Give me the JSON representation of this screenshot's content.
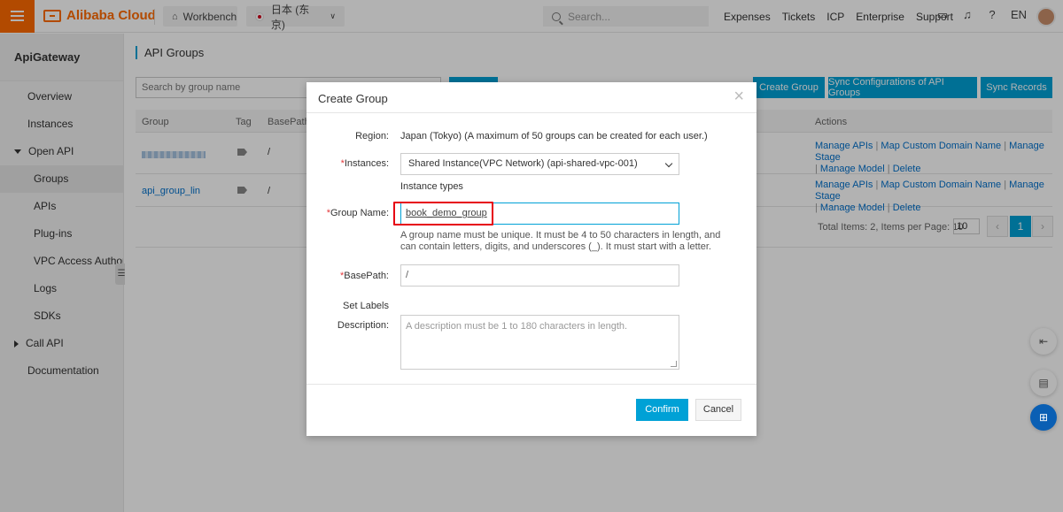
{
  "topbar": {
    "brand": "Alibaba Cloud",
    "workbench": "Workbench",
    "region": "日本 (东京)",
    "search_placeholder": "Search...",
    "links": [
      "Expenses",
      "Tickets",
      "ICP",
      "Enterprise",
      "Support"
    ],
    "language": "EN"
  },
  "sidebar": {
    "title": "ApiGateway",
    "items": {
      "overview": "Overview",
      "instances": "Instances",
      "open_api": "Open API",
      "groups": "Groups",
      "apis": "APIs",
      "plugins": "Plug-ins",
      "vpc": "VPC Access Authori...",
      "logs": "Logs",
      "sdks": "SDKs",
      "call_api": "Call API",
      "documentation": "Documentation"
    }
  },
  "main": {
    "title": "API Groups",
    "search_placeholder": "Search by group name",
    "buttons": {
      "create": "Create Group",
      "sync": "Sync Configurations of API Groups",
      "records": "Sync Records"
    },
    "columns": {
      "group": "Group",
      "tag": "Tag",
      "basepath": "BasePath",
      "actions": "Actions"
    },
    "rows": [
      {
        "group": "",
        "basepath": "/"
      },
      {
        "group": "api_group_lin",
        "basepath": "/"
      }
    ],
    "row_actions": {
      "manage_apis": "Manage APIs",
      "map_domain": "Map Custom Domain Name",
      "manage_stage": "Manage Stage",
      "manage_model": "Manage Model",
      "delete": "Delete"
    },
    "pagination": {
      "summary": "Total Items: 2, Items per Page: 10",
      "per_page": "10",
      "current": "1",
      "prev": "‹",
      "next": "›"
    }
  },
  "dialog": {
    "title": "Create Group",
    "close": "×",
    "region_label": "Region:",
    "region_value": "Japan (Tokyo) (A maximum of 50 groups can be created for each user.)",
    "instances_label": "Instances:",
    "instances_value": "Shared Instance(VPC Network) (api-shared-vpc-001)",
    "instance_types_link": "Instance types",
    "group_name_label": "Group Name:",
    "group_name_value": "book_demo_group",
    "group_name_hint": "A group name must be unique. It must be 4 to 50 characters in length, and can contain letters, digits, and underscores (_). It must start with a letter.",
    "basepath_label": "BasePath:",
    "basepath_value": "/",
    "set_labels_link": "Set Labels",
    "description_label": "Description:",
    "description_placeholder": "A description must be 1 to 180 characters in length.",
    "confirm": "Confirm",
    "cancel": "Cancel",
    "required_mark": "*"
  },
  "icons": [
    "menu-icon",
    "home-icon",
    "search-icon",
    "terminal-icon",
    "bell-icon",
    "help-icon",
    "tag-icon",
    "chat-icon",
    "apps-icon"
  ],
  "colors": {
    "brand": "#ff6a00",
    "primary": "#00a1d6",
    "link": "#0070cc",
    "highlight": "#e60012"
  }
}
